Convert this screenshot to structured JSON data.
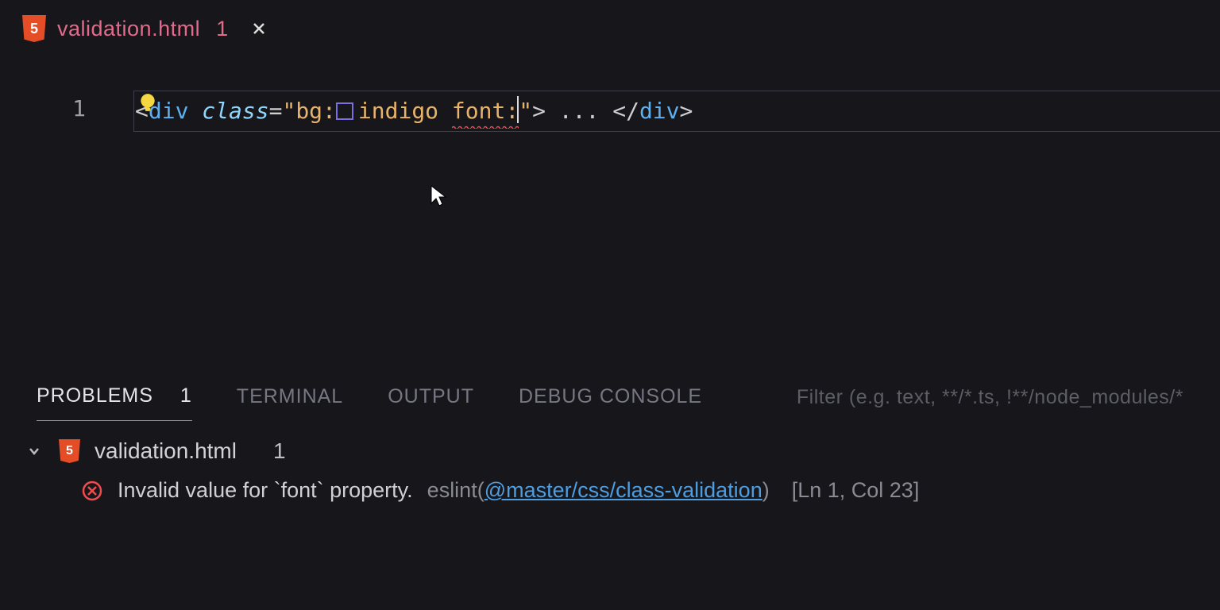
{
  "tab": {
    "filename": "validation.html",
    "problem_count": "1"
  },
  "editor": {
    "line_number": "1",
    "code": {
      "open_bracket": "<",
      "tag_open": "div",
      "space1": " ",
      "attr": "class",
      "eq": "=",
      "q1": "\"",
      "class_bg_prefix": "bg:",
      "class_bg_color": "indigo",
      "space2": " ",
      "class_font": "font:",
      "q2": "\"",
      "close_bracket": ">",
      "content": " ... ",
      "open_close_bracket": "</",
      "tag_close": "div",
      "end_bracket": ">"
    }
  },
  "panel": {
    "tabs": {
      "problems": "PROBLEMS",
      "problems_count": "1",
      "terminal": "TERMINAL",
      "output": "OUTPUT",
      "debug_console": "DEBUG CONSOLE"
    },
    "filter_placeholder": "Filter (e.g. text, **/*.ts, !**/node_modules/*",
    "file": {
      "name": "validation.html",
      "count": "1"
    },
    "issue": {
      "message": "Invalid value for `font` property.",
      "source": "eslint",
      "rule_open": "(",
      "rule": "@master/css/class-validation",
      "rule_close": ")",
      "location": "[Ln 1, Col 23]"
    }
  }
}
